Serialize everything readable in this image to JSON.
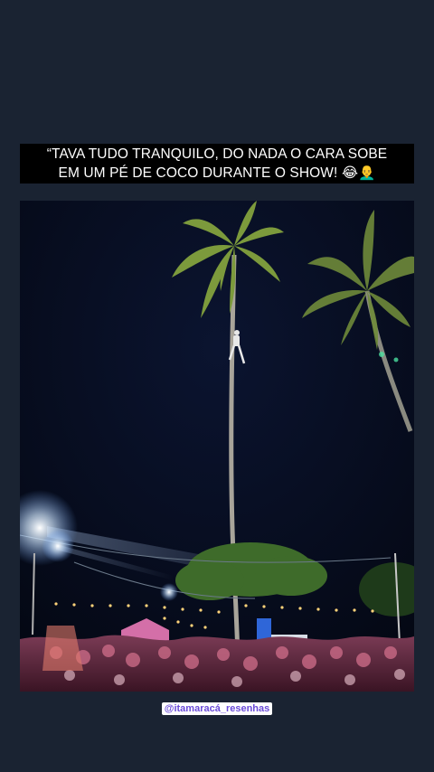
{
  "background_color": "#1a2332",
  "caption": {
    "line1": "“TAVA TUDO TRANQUILO, DO NADA O CARA SOBE",
    "line2": "EM UM PÉ DE COCO DURANTE O SHOW! 😂👨‍🦲"
  },
  "video": {
    "description_icon": "night-concert-palm-tree-video"
  },
  "handle": {
    "text": "@itamaracá_resenhas",
    "color": "#6a4bd8"
  }
}
